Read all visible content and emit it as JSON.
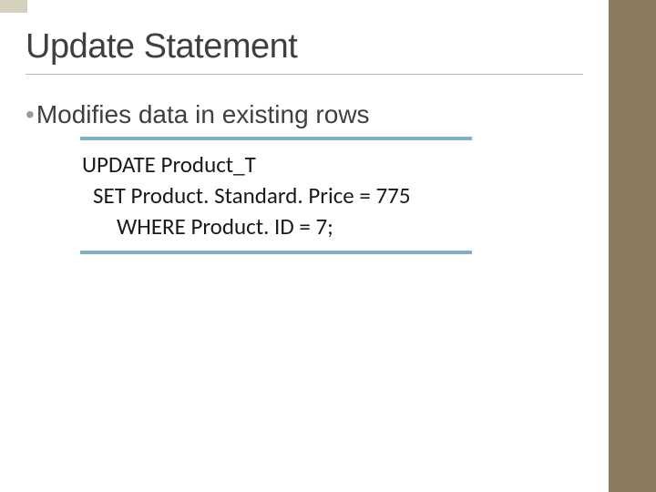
{
  "title": "Update Statement",
  "bullet": {
    "dot": "•",
    "text": "Modifies data in existing rows"
  },
  "code": {
    "line1": "UPDATE Product_T",
    "line2": "SET Product. Standard. Price = 775",
    "line3": "WHERE Product. ID = 7;"
  }
}
